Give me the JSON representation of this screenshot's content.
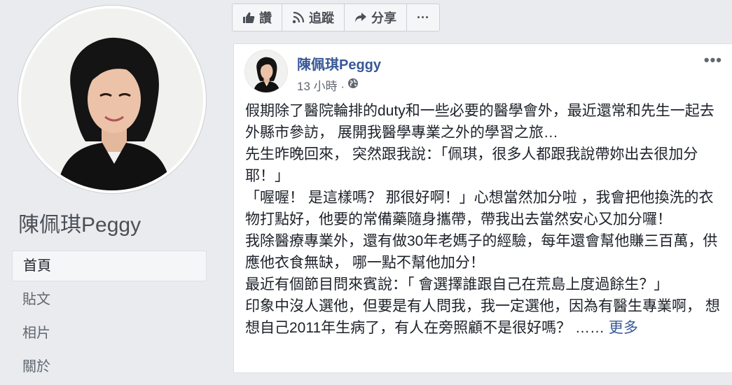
{
  "profile": {
    "name": "陳佩琪Peggy"
  },
  "nav": {
    "items": [
      {
        "label": "首頁",
        "active": true
      },
      {
        "label": "貼文",
        "active": false
      },
      {
        "label": "相片",
        "active": false
      },
      {
        "label": "關於",
        "active": false
      }
    ]
  },
  "actions": {
    "like_label": "讚",
    "follow_label": "追蹤",
    "share_label": "分享",
    "more_label": "···"
  },
  "post": {
    "author": "陳佩琪Peggy",
    "time": "13 小時 ·",
    "menu": "•••",
    "paragraphs": [
      "假期除了醫院輪排的duty和一些必要的醫學會外，最近還常和先生一起去外縣市參訪， 展開我醫學專業之外的學習之旅…",
      "先生昨晚回來， 突然跟我說：「佩琪，很多人都跟我說帶妳出去很加分耶！」",
      "「喔喔！ 是這樣嗎？ 那很好啊！」心想當然加分啦 ，我會把他換洗的衣物打點好，他要的常備藥隨身攜帶，帶我出去當然安心又加分囉！",
      "我除醫療專業外，還有做30年老媽子的經驗，每年還會幫他賺三百萬，供應他衣食無缺， 哪一點不幫他加分！",
      "最近有個節目問來賓說：「 會選擇誰跟自己在荒島上度過餘生？」"
    ],
    "last_paragraph": "印象中沒人選他，但要是有人問我，我一定選他，因為有醫生專業啊， 想想自己2011年生病了，有人在旁照顧不是很好嗎？ ……",
    "see_more": "更多"
  },
  "colors": {
    "link": "#385898",
    "background": "#e9ebee"
  }
}
